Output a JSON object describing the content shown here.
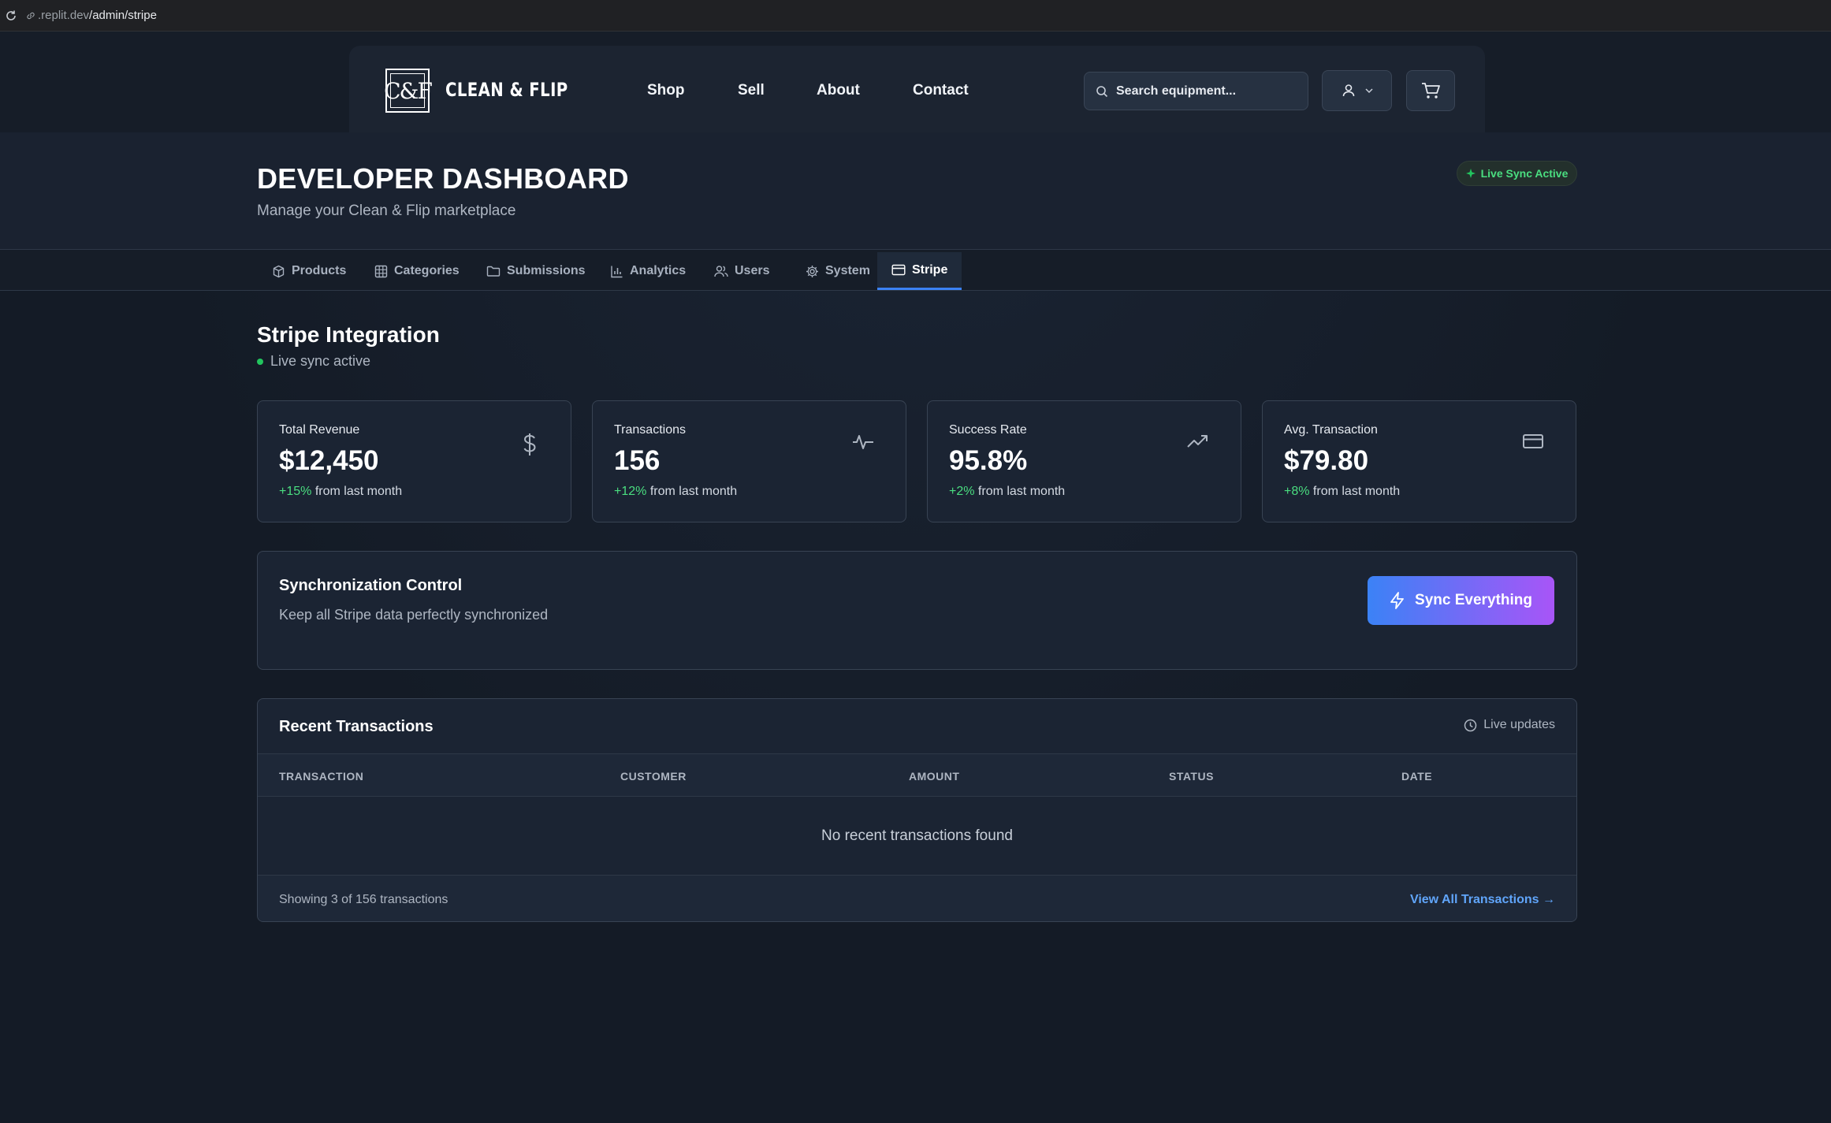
{
  "browser": {
    "url_host": ".replit.dev",
    "url_path": "/admin/stripe"
  },
  "header": {
    "logo_text": "C&F",
    "brand": "CLEAN & FLIP",
    "nav": [
      "Shop",
      "Sell",
      "About",
      "Contact"
    ],
    "search_placeholder": "Search equipment...",
    "icons": {
      "search": "search-icon",
      "user": "user-icon",
      "cart": "cart-icon"
    }
  },
  "dashboard": {
    "title": "DEVELOPER DASHBOARD",
    "subtitle": "Manage your Clean & Flip marketplace",
    "live_badge": "Live Sync Active"
  },
  "tabs": [
    {
      "label": "Products",
      "icon": "package-icon"
    },
    {
      "label": "Categories",
      "icon": "grid-icon"
    },
    {
      "label": "Submissions",
      "icon": "folder-icon"
    },
    {
      "label": "Analytics",
      "icon": "bar-chart-icon"
    },
    {
      "label": "Users",
      "icon": "users-icon"
    },
    {
      "label": "System",
      "icon": "gear-icon"
    },
    {
      "label": "Stripe",
      "icon": "credit-card-icon",
      "active": true
    }
  ],
  "stripe": {
    "title": "Stripe Integration",
    "status": "Live sync active",
    "stats": [
      {
        "label": "Total Revenue",
        "value": "$12,450",
        "change": "+15%",
        "suffix": "from last month",
        "icon": "dollar-icon"
      },
      {
        "label": "Transactions",
        "value": "156",
        "change": "+12%",
        "suffix": "from last month",
        "icon": "activity-icon"
      },
      {
        "label": "Success Rate",
        "value": "95.8%",
        "change": "+2%",
        "suffix": "from last month",
        "icon": "trending-up-icon"
      },
      {
        "label": "Avg. Transaction",
        "value": "$79.80",
        "change": "+8%",
        "suffix": "from last month",
        "icon": "credit-card-icon"
      }
    ],
    "sync": {
      "title": "Synchronization Control",
      "subtitle": "Keep all Stripe data perfectly synchronized",
      "button": "Sync Everything"
    },
    "transactions": {
      "title": "Recent Transactions",
      "live_label": "Live updates",
      "columns": [
        "TRANSACTION",
        "CUSTOMER",
        "AMOUNT",
        "STATUS",
        "DATE"
      ],
      "empty_text": "No recent transactions found",
      "footer_count": "Showing 3 of 156 transactions",
      "view_all": "View All Transactions →"
    }
  },
  "colors": {
    "accent_blue": "#3b82f6",
    "accent_purple": "#a855f7",
    "success_green": "#4ade80"
  }
}
